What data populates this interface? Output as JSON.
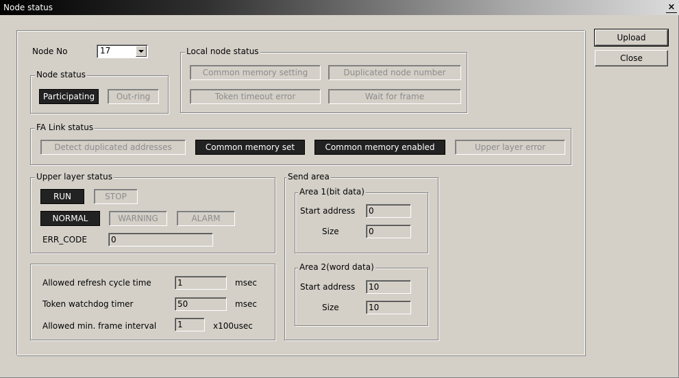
{
  "window": {
    "title": "Node status",
    "close_glyph": "×",
    "close_icon": "close-icon"
  },
  "buttons": {
    "upload": "Upload",
    "close": "Close"
  },
  "node": {
    "label": "Node No",
    "value": "17"
  },
  "node_status": {
    "title": "Node status",
    "participating": "Participating",
    "out_ring": "Out-ring",
    "participating_active": true,
    "out_ring_active": false
  },
  "local_node_status": {
    "title": "Local node status",
    "common_memory_setting": "Common memory setting",
    "duplicated_node_number": "Duplicated node number",
    "token_timeout_error": "Token timeout error",
    "wait_for_frame": "Wait for frame"
  },
  "fa_link_status": {
    "title": "FA Link status",
    "detect_duplicated": "Detect duplicated addresses",
    "common_memory_set": "Common memory set",
    "common_memory_enabled": "Common memory enabled",
    "upper_layer_error": "Upper layer error"
  },
  "upper_layer_status": {
    "title": "Upper layer status",
    "run": "RUN",
    "stop": "STOP",
    "normal": "NORMAL",
    "warning": "WARNING",
    "alarm": "ALARM",
    "err_code_label": "ERR_CODE",
    "err_code_value": "0"
  },
  "timing": {
    "refresh_label": "Allowed refresh cycle time",
    "refresh_value": "1",
    "refresh_unit": "msec",
    "watchdog_label": "Token watchdog timer",
    "watchdog_value": "50",
    "watchdog_unit": "msec",
    "frame_label": "Allowed min. frame interval",
    "frame_value": "1",
    "frame_unit": "x100usec"
  },
  "send_area": {
    "title": "Send area",
    "area1": {
      "title": "Area 1(bit data)",
      "start_label": "Start address",
      "start_value": "0",
      "size_label": "Size",
      "size_value": "0"
    },
    "area2": {
      "title": "Area 2(word data)",
      "start_label": "Start address",
      "start_value": "10",
      "size_label": "Size",
      "size_value": "10"
    }
  },
  "colors": {
    "face": "#d4d0c8",
    "active_indicator": "#222222",
    "inactive_text": "#8c8c8c"
  }
}
